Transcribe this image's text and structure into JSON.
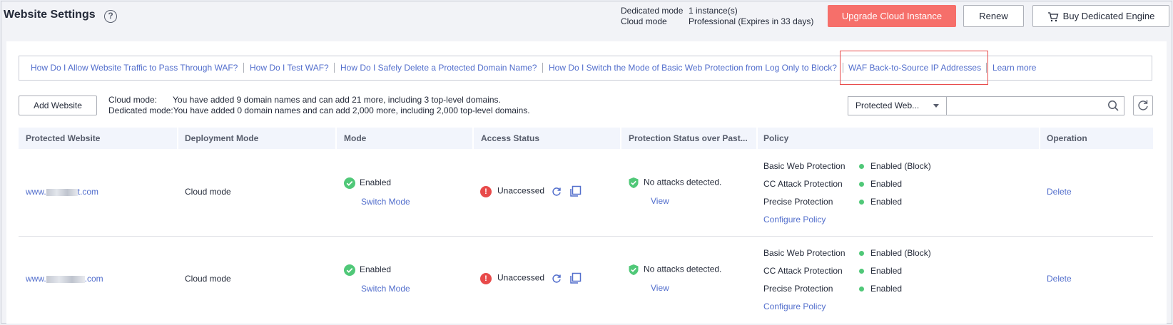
{
  "header": {
    "title": "Website Settings",
    "mode_rows": [
      {
        "label": "Dedicated mode",
        "value": "1 instance(s)"
      },
      {
        "label": "Cloud mode",
        "value": "Professional (Expires in 33 days)"
      }
    ],
    "upgrade_label": "Upgrade Cloud Instance",
    "renew_label": "Renew",
    "buy_label": "Buy Dedicated Engine"
  },
  "faq": [
    "How Do I Allow Website Traffic to Pass Through WAF?",
    "How Do I Test WAF?",
    "How Do I Safely Delete a Protected Domain Name?",
    "How Do I Switch the Mode of Basic Web Protection from Log Only to Block?",
    "WAF Back-to-Source IP Addresses",
    "Learn more"
  ],
  "toolbar": {
    "add_label": "Add Website",
    "quota": [
      {
        "label": "Cloud mode:",
        "text": "You have added 9 domain names and can add 21 more, including 3 top-level domains."
      },
      {
        "label": "Dedicated mode:",
        "text": "You have added 0 domain names and can add 2,000 more, including 2,000 top-level domains."
      }
    ],
    "filter_value": "Protected Web...",
    "search_placeholder": ""
  },
  "table": {
    "columns": [
      "Protected Website",
      "Deployment Mode",
      "Mode",
      "Access Status",
      "Protection Status over Past...",
      "Policy",
      "Operation"
    ],
    "rows": [
      {
        "site_prefix": "www.",
        "site_suffix": "t.com",
        "deployment": "Cloud mode",
        "mode": "Enabled",
        "switch_label": "Switch Mode",
        "access": "Unaccessed",
        "protection": "No attacks detected.",
        "view_label": "View",
        "policies": [
          {
            "name": "Basic Web Protection",
            "status": "Enabled (Block)"
          },
          {
            "name": "CC Attack Protection",
            "status": "Enabled"
          },
          {
            "name": "Precise Protection",
            "status": "Enabled"
          }
        ],
        "configure_label": "Configure Policy",
        "operation": "Delete"
      },
      {
        "site_prefix": "www.",
        "site_suffix": ".com",
        "deployment": "Cloud mode",
        "mode": "Enabled",
        "switch_label": "Switch Mode",
        "access": "Unaccessed",
        "protection": "No attacks detected.",
        "view_label": "View",
        "policies": [
          {
            "name": "Basic Web Protection",
            "status": "Enabled (Block)"
          },
          {
            "name": "CC Attack Protection",
            "status": "Enabled"
          },
          {
            "name": "Precise Protection",
            "status": "Enabled"
          }
        ],
        "configure_label": "Configure Policy",
        "operation": "Delete"
      }
    ]
  },
  "colors": {
    "accent_red": "#f66f6a",
    "link": "#526ecc",
    "success": "#50c878",
    "error": "#e84a4a"
  }
}
